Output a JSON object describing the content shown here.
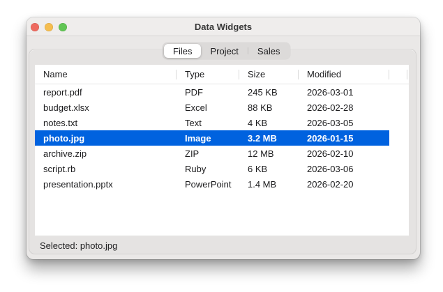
{
  "window": {
    "title": "Data Widgets"
  },
  "traffic_lights": [
    {
      "name": "close-button",
      "color": "#ee6a5f"
    },
    {
      "name": "minimize-button",
      "color": "#f5bd4f"
    },
    {
      "name": "zoom-button",
      "color": "#61c554"
    }
  ],
  "tabs": [
    {
      "label": "Files",
      "selected": true
    },
    {
      "label": "Project",
      "selected": false
    },
    {
      "label": "Sales",
      "selected": false
    }
  ],
  "table": {
    "columns": [
      "Name",
      "Type",
      "Size",
      "Modified"
    ],
    "rows": [
      {
        "name": "report.pdf",
        "type": "PDF",
        "size": "245 KB",
        "modified": "2026-03-01"
      },
      {
        "name": "budget.xlsx",
        "type": "Excel",
        "size": "88 KB",
        "modified": "2026-02-28"
      },
      {
        "name": "notes.txt",
        "type": "Text",
        "size": "4 KB",
        "modified": "2026-03-05"
      },
      {
        "name": "photo.jpg",
        "type": "Image",
        "size": "3.2 MB",
        "modified": "2026-01-15"
      },
      {
        "name": "archive.zip",
        "type": "ZIP",
        "size": "12 MB",
        "modified": "2026-02-10"
      },
      {
        "name": "script.rb",
        "type": "Ruby",
        "size": "6 KB",
        "modified": "2026-03-06"
      },
      {
        "name": "presentation.pptx",
        "type": "PowerPoint",
        "size": "1.4 MB",
        "modified": "2026-02-20"
      }
    ],
    "selected_index": 3,
    "selection_color": "#0062df"
  },
  "status": {
    "text": "Selected: photo.jpg"
  }
}
